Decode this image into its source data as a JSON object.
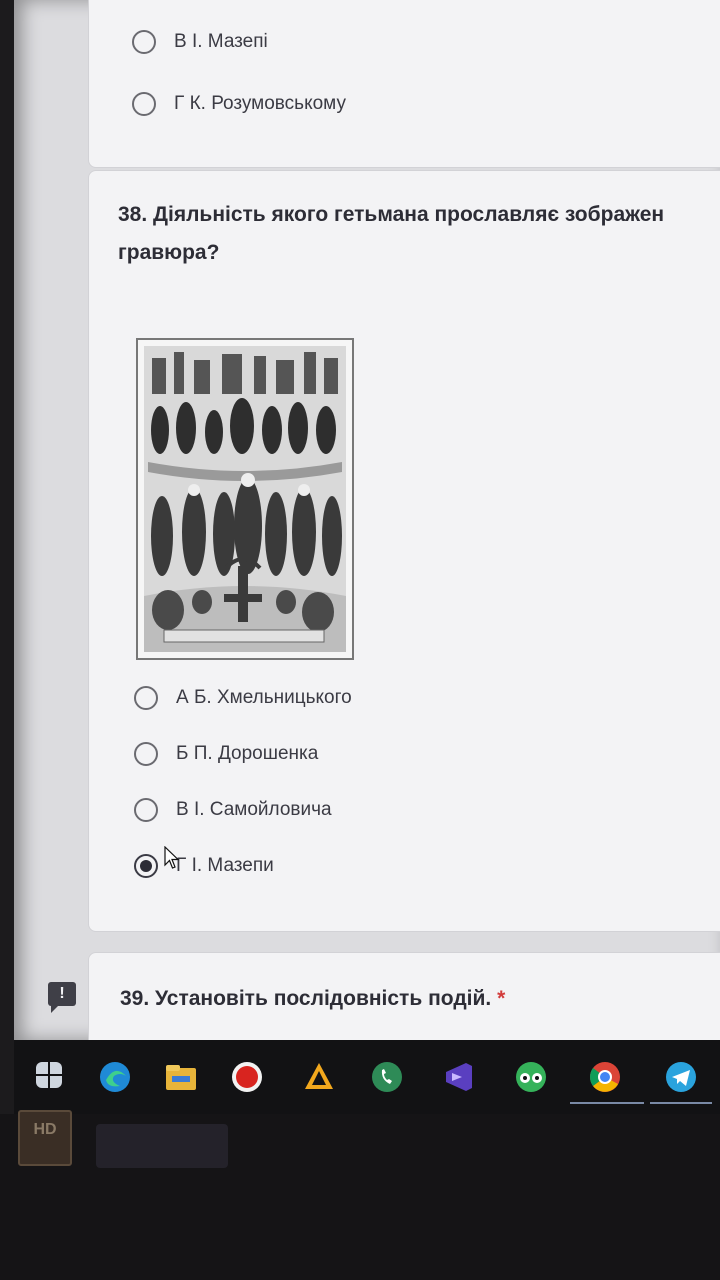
{
  "prev_question": {
    "options": [
      {
        "label": "В І. Мазепі",
        "checked": false
      },
      {
        "label": "Г К. Розумовському",
        "checked": false
      }
    ]
  },
  "q38": {
    "title_line1": "38. Діяльність якого гетьмана прославляє зображен",
    "title_line2": "гравюра?",
    "image_name": "engraving",
    "options": [
      {
        "label": "А Б. Хмельницького",
        "checked": false
      },
      {
        "label": "Б П. Дорошенка",
        "checked": false
      },
      {
        "label": "В І. Самойловича",
        "checked": false
      },
      {
        "label": "Г І. Мазепи",
        "checked": true
      }
    ]
  },
  "q39": {
    "title": "39. Установіть послідовність подій.",
    "required_mark": "*"
  },
  "sidebar": {
    "feedback_icon": "!"
  },
  "bezel": {
    "sticker_text": "HD"
  },
  "colors": {
    "page_bg": "#dcdcdf",
    "card_bg": "#f3f3f5",
    "title_text": "#2d2d36",
    "required": "#d23b3b",
    "taskbar": "#121214"
  },
  "taskbar_icons": [
    "windows-start-icon",
    "edge-icon",
    "file-explorer-icon",
    "record-icon",
    "amd-icon",
    "viber-icon",
    "vs-icon",
    "tripadvisor-icon",
    "chrome-icon",
    "telegram-icon"
  ]
}
